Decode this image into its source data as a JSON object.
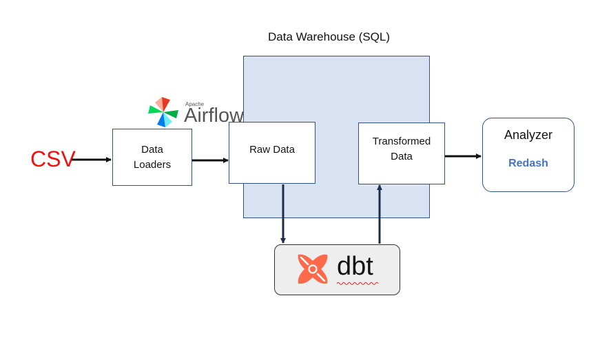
{
  "warehouse": {
    "title": "Data Warehouse (SQL)",
    "fill": "#dae3f3"
  },
  "source": {
    "label": "CSV",
    "color": "#ee1111"
  },
  "loaders": {
    "line1": "Data",
    "line2": "Loaders"
  },
  "raw": {
    "label": "Raw Data"
  },
  "transformed": {
    "line1": "Transformed",
    "line2": "Data"
  },
  "analyzer": {
    "title": "Analyzer",
    "tool": "Redash",
    "tool_color": "#4472c4"
  },
  "airflow": {
    "small": "Apache",
    "name": "Airflow",
    "icon": "airflow-pinwheel-icon"
  },
  "dbt": {
    "name": "dbt",
    "icon": "dbt-logo-icon",
    "logo_color": "#ff694b"
  }
}
